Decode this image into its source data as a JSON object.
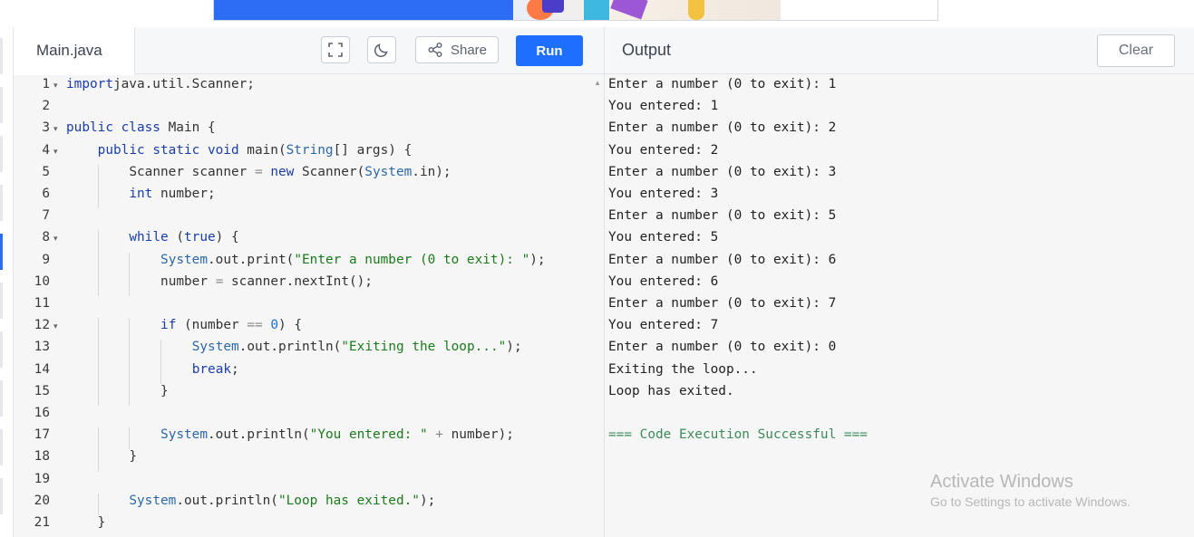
{
  "editor": {
    "file_tab": "Main.java",
    "share_label": "Share",
    "run_label": "Run",
    "lines": [
      {
        "n": "1",
        "fold": true,
        "indent": 0,
        "tokens": [
          [
            "kw",
            "import"
          ],
          [
            "",
            "java.util.Scanner;"
          ]
        ]
      },
      {
        "n": "2",
        "fold": false,
        "indent": 0,
        "tokens": []
      },
      {
        "n": "3",
        "fold": true,
        "indent": 0,
        "tokens": [
          [
            "kw",
            "public class"
          ],
          [
            "",
            " Main {"
          ]
        ]
      },
      {
        "n": "4",
        "fold": true,
        "indent": 1,
        "tokens": [
          [
            "kw",
            "public static void"
          ],
          [
            "",
            " main("
          ],
          [
            "cls",
            "String"
          ],
          [
            "",
            "[] args) {"
          ]
        ]
      },
      {
        "n": "5",
        "fold": false,
        "indent": 2,
        "tokens": [
          [
            "",
            "Scanner scanner "
          ],
          [
            "op",
            "="
          ],
          [
            "kw",
            " new"
          ],
          [
            "",
            " Scanner("
          ],
          [
            "cls",
            "System"
          ],
          [
            "",
            ".in);"
          ]
        ]
      },
      {
        "n": "6",
        "fold": false,
        "indent": 2,
        "tokens": [
          [
            "kw",
            "int"
          ],
          [
            "",
            " number;"
          ]
        ]
      },
      {
        "n": "7",
        "fold": false,
        "indent": 0,
        "tokens": []
      },
      {
        "n": "8",
        "fold": true,
        "indent": 2,
        "tokens": [
          [
            "kw",
            "while"
          ],
          [
            "",
            " ("
          ],
          [
            "kw",
            "true"
          ],
          [
            "",
            ") {"
          ]
        ]
      },
      {
        "n": "9",
        "fold": false,
        "indent": 3,
        "tokens": [
          [
            "cls",
            "System"
          ],
          [
            "",
            ".out.print("
          ],
          [
            "str",
            "\"Enter a number (0 to exit): \""
          ],
          [
            "",
            ");"
          ]
        ]
      },
      {
        "n": "10",
        "fold": false,
        "indent": 3,
        "tokens": [
          [
            "",
            "number "
          ],
          [
            "op",
            "="
          ],
          [
            "",
            " scanner.nextInt();"
          ]
        ]
      },
      {
        "n": "11",
        "fold": false,
        "indent": 0,
        "tokens": []
      },
      {
        "n": "12",
        "fold": true,
        "indent": 3,
        "tokens": [
          [
            "kw",
            "if"
          ],
          [
            "",
            " (number "
          ],
          [
            "op",
            "=="
          ],
          [
            "num",
            " 0"
          ],
          [
            "",
            ") {"
          ]
        ]
      },
      {
        "n": "13",
        "fold": false,
        "indent": 4,
        "tokens": [
          [
            "cls",
            "System"
          ],
          [
            "",
            ".out.println("
          ],
          [
            "str",
            "\"Exiting the loop...\""
          ],
          [
            "",
            ");"
          ]
        ]
      },
      {
        "n": "14",
        "fold": false,
        "indent": 4,
        "tokens": [
          [
            "kw",
            "break"
          ],
          [
            "",
            ";"
          ]
        ]
      },
      {
        "n": "15",
        "fold": false,
        "indent": 3,
        "tokens": [
          [
            "",
            "}"
          ]
        ]
      },
      {
        "n": "16",
        "fold": false,
        "indent": 0,
        "tokens": []
      },
      {
        "n": "17",
        "fold": false,
        "indent": 3,
        "tokens": [
          [
            "cls",
            "System"
          ],
          [
            "",
            ".out.println("
          ],
          [
            "str",
            "\"You entered: \""
          ],
          [
            "op",
            " +"
          ],
          [
            "",
            " number);"
          ]
        ]
      },
      {
        "n": "18",
        "fold": false,
        "indent": 2,
        "tokens": [
          [
            "",
            "}"
          ]
        ]
      },
      {
        "n": "19",
        "fold": false,
        "indent": 0,
        "tokens": []
      },
      {
        "n": "20",
        "fold": false,
        "indent": 2,
        "tokens": [
          [
            "cls",
            "System"
          ],
          [
            "",
            ".out.println("
          ],
          [
            "str",
            "\"Loop has exited.\""
          ],
          [
            "",
            ");"
          ]
        ]
      },
      {
        "n": "21",
        "fold": false,
        "indent": 1,
        "tokens": [
          [
            "",
            "}"
          ]
        ]
      }
    ]
  },
  "output": {
    "title": "Output",
    "clear_label": "Clear",
    "lines": [
      "Enter a number (0 to exit): 1",
      "You entered: 1",
      "Enter a number (0 to exit): 2",
      "You entered: 2",
      "Enter a number (0 to exit): 3",
      "You entered: 3",
      "Enter a number (0 to exit): 5",
      "You entered: 5",
      "Enter a number (0 to exit): 6",
      "You entered: 6",
      "Enter a number (0 to exit): 7",
      "You entered: 7",
      "Enter a number (0 to exit): 0",
      "Exiting the loop...",
      "Loop has exited.",
      "",
      "=== Code Execution Successful ==="
    ]
  },
  "watermark": {
    "line1": "Activate Windows",
    "line2": "Go to Settings to activate Windows."
  },
  "colors": {
    "accent": "#1f6fff",
    "keyword": "#1a3ea8",
    "string": "#1b7a1b",
    "success": "#3c8a5a"
  }
}
